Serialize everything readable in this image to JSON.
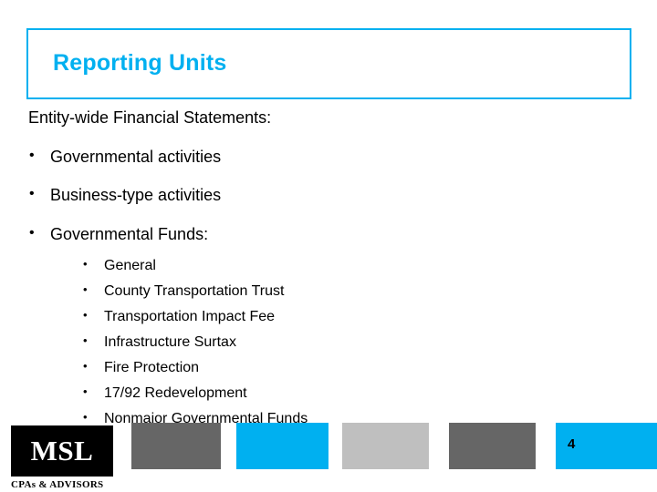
{
  "slide": {
    "title": "Reporting Units",
    "lead_line": "Entity-wide Financial Statements:",
    "bullets": [
      {
        "marker": "•",
        "text": "Governmental activities"
      },
      {
        "marker": "•",
        "text": "Business-type activities"
      },
      {
        "marker": "•",
        "text": "Governmental Funds:"
      }
    ],
    "sub_bullets": [
      {
        "marker": "•",
        "text": "General"
      },
      {
        "marker": "•",
        "text": "County Transportation Trust"
      },
      {
        "marker": "•",
        "text": "Transportation Impact Fee"
      },
      {
        "marker": "•",
        "text": "Infrastructure Surtax"
      },
      {
        "marker": "•",
        "text": "Fire Protection"
      },
      {
        "marker": "•",
        "text": "17/92 Redevelopment"
      },
      {
        "marker": "•",
        "text": "Nonmajor Governmental Funds"
      }
    ],
    "page_number": "4",
    "logo": {
      "mark_text": "MSL",
      "tagline": "CPAs & ADVISORS"
    },
    "colors": {
      "accent": "#00b0f0",
      "dark_gray": "#666666",
      "light_gray": "#bfbfbf",
      "text": "#000000"
    }
  }
}
